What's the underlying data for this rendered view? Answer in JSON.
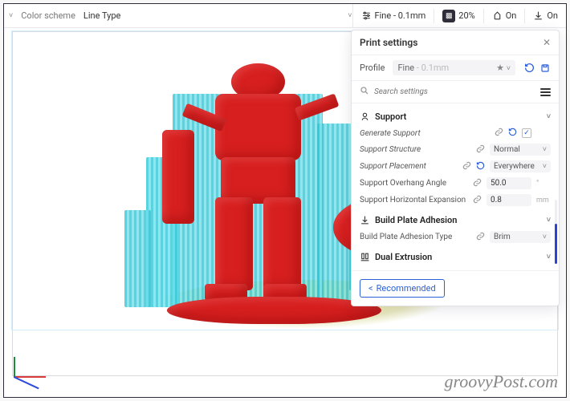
{
  "toolbar": {
    "color_scheme_label": "Color scheme",
    "color_scheme_value": "Line Type",
    "quality_label": "Fine - 0.1mm",
    "infill_label": "20%",
    "on_label_1": "On",
    "on_label_2": "On"
  },
  "panel": {
    "title": "Print settings",
    "profile_label": "Profile",
    "profile_value": "Fine",
    "profile_detail": "- 0.1mm",
    "search_placeholder": "Search settings",
    "sections": {
      "support": {
        "title": "Support",
        "generate_support": "Generate Support",
        "generate_support_checked": "✓",
        "support_structure": "Support Structure",
        "support_structure_value": "Normal",
        "support_placement": "Support Placement",
        "support_placement_value": "Everywhere",
        "support_overhang_angle": "Support Overhang Angle",
        "support_overhang_angle_value": "50.0",
        "support_horizontal_expansion": "Support Horizontal Expansion",
        "support_horizontal_expansion_value": "0.8",
        "unit_mm": "mm"
      },
      "adhesion": {
        "title": "Build Plate Adhesion",
        "type_label": "Build Plate Adhesion Type",
        "type_value": "Brim"
      },
      "dual": {
        "title": "Dual Extrusion"
      }
    },
    "recommended_label": "Recommended"
  },
  "watermark": "groovyPost.com"
}
